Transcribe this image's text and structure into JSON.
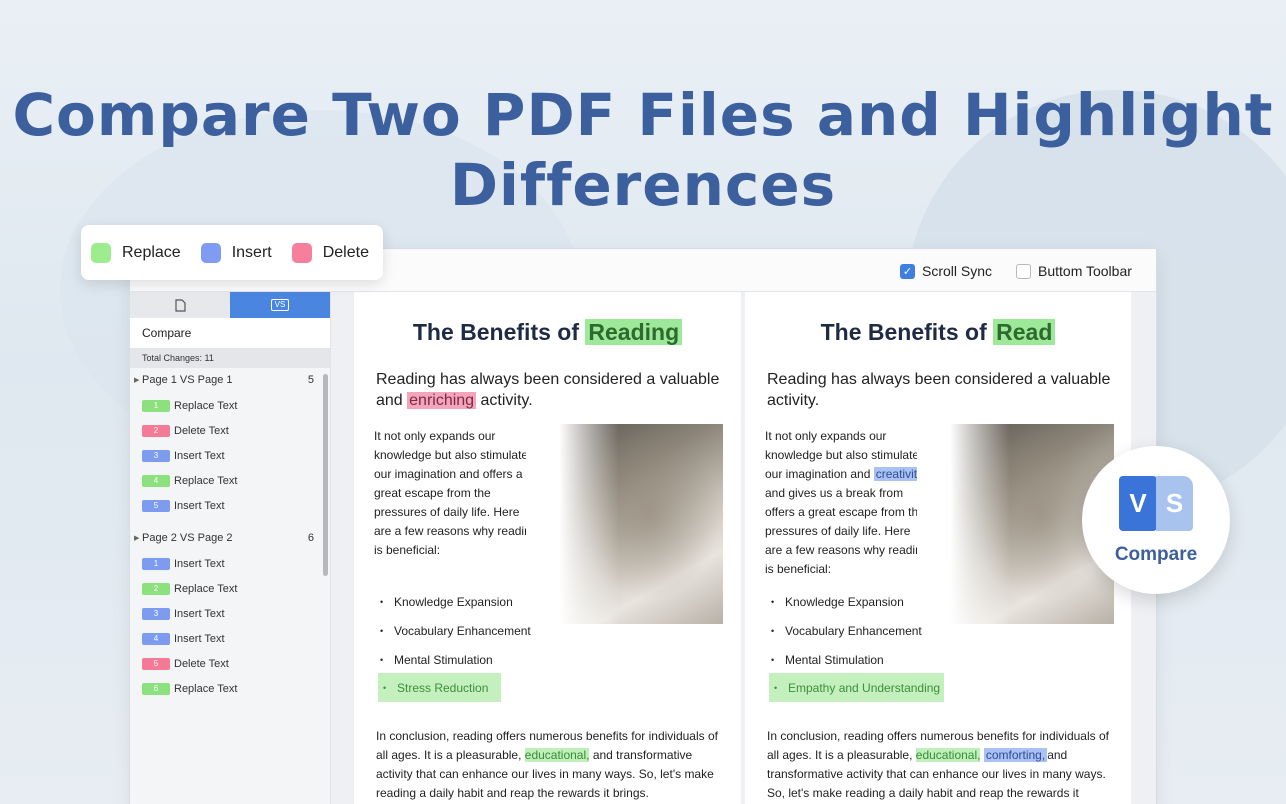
{
  "hero": {
    "line1": "Compare Two PDF Files and Highlight",
    "line2": "Differences"
  },
  "legend": [
    {
      "label": "Replace",
      "color": "#9ded8f"
    },
    {
      "label": "Insert",
      "color": "#7f9cf2"
    },
    {
      "label": "Delete",
      "color": "#f57f9c"
    }
  ],
  "toolbar": {
    "scroll_sync": "Scroll Sync",
    "scroll_sync_checked": true,
    "bottom_toolbar": "Buttom Toolbar",
    "bottom_toolbar_checked": false
  },
  "sidebar": {
    "compare_label": "Compare",
    "total": "Total Changes: 11",
    "groups": [
      {
        "title": "Page 1 VS Page 1",
        "count": "5",
        "items": [
          {
            "n": "1",
            "label": "Replace Text",
            "color": "#8de07e"
          },
          {
            "n": "2",
            "label": "Delete Text",
            "color": "#f47a98"
          },
          {
            "n": "3",
            "label": "Insert Text",
            "color": "#7d9cf0"
          },
          {
            "n": "4",
            "label": "Replace Text",
            "color": "#8de07e"
          },
          {
            "n": "5",
            "label": "Insert Text",
            "color": "#7d9cf0"
          }
        ]
      },
      {
        "title": "Page 2 VS Page 2",
        "count": "6",
        "items": [
          {
            "n": "1",
            "label": "Insert Text",
            "color": "#7d9cf0"
          },
          {
            "n": "2",
            "label": "Replace Text",
            "color": "#8de07e"
          },
          {
            "n": "3",
            "label": "Insert Text",
            "color": "#7d9cf0"
          },
          {
            "n": "4",
            "label": "Insert Text",
            "color": "#7d9cf0"
          },
          {
            "n": "5",
            "label": "Delete Text",
            "color": "#f47a98"
          },
          {
            "n": "6",
            "label": "Replace Text",
            "color": "#8de07e"
          }
        ]
      }
    ]
  },
  "left": {
    "title_pre": "The Benefits of ",
    "title_hl": "Reading",
    "intro_pre": "Reading has always been considered a valuable",
    "intro_and": "and ",
    "intro_hl": "enriching",
    "intro_post": " activity.",
    "para_lines": [
      "It not only expands our",
      "knowledge but also stimulates",
      "our imagination and offers a",
      "great escape from the",
      "pressures of daily life. Here",
      "are a few reasons why reading",
      "is beneficial:"
    ],
    "bullets": [
      "Knowledge Expansion",
      "Vocabulary Enhancement",
      "Mental Stimulation"
    ],
    "bullet_hl": "Stress Reduction",
    "concl_1": "In conclusion, reading offers numerous benefits for individuals of",
    "concl_2a": "all ages. It is a pleasurable, ",
    "concl_2hl": "educational,",
    "concl_2b": " and transformative",
    "concl_3": "activity that can enhance our lives in many ways. So, let's make",
    "concl_4": "reading a daily habit and reap the rewards it brings."
  },
  "right": {
    "title_pre": "The Benefits of ",
    "title_hl": "Read",
    "intro_1": "Reading has always been considered a valuable",
    "intro_2": "activity.",
    "para_1": "It not only expands our",
    "para_2": "knowledge but also stimulates",
    "para_3a": "our imagination and ",
    "para_3hl": "creativity,",
    "para_lines": [
      "and gives us a break from",
      "offers a great escape from the",
      "pressures of daily life. Here",
      "are a few reasons why reading",
      "is beneficial:"
    ],
    "bullets": [
      "Knowledge Expansion",
      "Vocabulary Enhancement",
      "Mental Stimulation"
    ],
    "bullet_hl": "Empathy and Understanding",
    "concl_1": "In conclusion, reading offers numerous benefits for individuals of",
    "concl_2a": "all ages. It is a pleasurable, ",
    "concl_2hl": "educational,",
    "concl_2mid": " ",
    "concl_2hl2": "comforting,",
    "concl_2b": "and",
    "concl_3": "transformative activity that can enhance our lives in many ways.",
    "concl_4": "So, let's make reading a daily habit and reap the rewards it brings."
  },
  "badge": {
    "v": "V",
    "s": "S",
    "label": "Compare"
  }
}
